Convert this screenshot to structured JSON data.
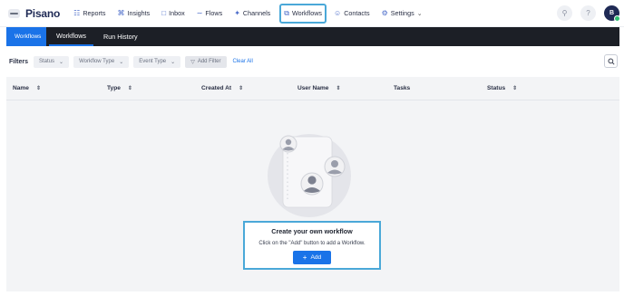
{
  "brand": {
    "name": "Pisano"
  },
  "nav": {
    "items": [
      {
        "label": "Reports",
        "icon": "chart-icon",
        "glyph": "☷"
      },
      {
        "label": "Insights",
        "icon": "insights-icon",
        "glyph": "⌘"
      },
      {
        "label": "Inbox",
        "icon": "inbox-icon",
        "glyph": "□"
      },
      {
        "label": "Flows",
        "icon": "flows-icon",
        "glyph": "⫧"
      },
      {
        "label": "Channels",
        "icon": "channels-icon",
        "glyph": "✦"
      },
      {
        "label": "Workflows",
        "icon": "workflows-icon",
        "glyph": "⧉",
        "active": true
      },
      {
        "label": "Contacts",
        "icon": "contacts-icon",
        "glyph": "☺"
      },
      {
        "label": "Settings",
        "icon": "gear-icon",
        "glyph": "⚙"
      }
    ],
    "avatar_initial": "B",
    "search_icon": "⚲",
    "help_icon": "?"
  },
  "subnav": {
    "crumb": "Workflows",
    "tabs": [
      {
        "label": "Workflows",
        "active": true
      },
      {
        "label": "Run History",
        "active": false
      }
    ]
  },
  "filters": {
    "label": "Filters",
    "status": "Status",
    "workflow_type": "Workflow Type",
    "event_type": "Event Type",
    "add_filter": "Add Filter",
    "clear_all": "Clear All"
  },
  "table": {
    "columns": [
      {
        "label": "Name",
        "sortable": true
      },
      {
        "label": "Type",
        "sortable": true
      },
      {
        "label": "Created At",
        "sortable": true
      },
      {
        "label": "User Name",
        "sortable": true
      },
      {
        "label": "Tasks",
        "sortable": false
      },
      {
        "label": "Status",
        "sortable": true
      }
    ]
  },
  "empty_state": {
    "title": "Create your own workflow",
    "description": "Click on the \"Add\" button to add a Workflow.",
    "add_label": "Add"
  },
  "colors": {
    "accent": "#1a73e8",
    "highlight": "#4aa8d8",
    "subnav_bg": "#1c1f26",
    "brand": "#1f2a55"
  }
}
